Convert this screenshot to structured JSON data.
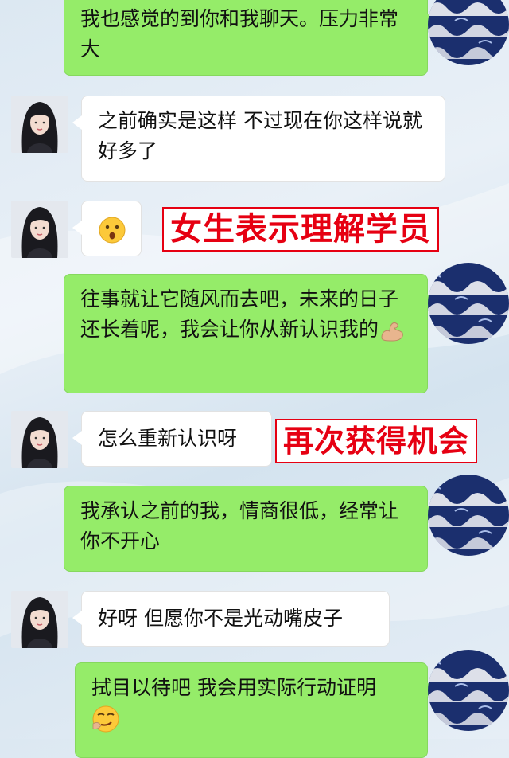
{
  "messages": [
    {
      "from": "me",
      "text": "我也感觉的到你和我聊天。压力非常大"
    },
    {
      "from": "her",
      "text": "之前确实是这样 不过现在你这样说就好多了"
    },
    {
      "from": "her",
      "text": "",
      "emoji": "surprised-face-emoji"
    },
    {
      "from": "me",
      "text": "往事就让它随风而去吧，未来的日子还长着呢，我会让你从新认识我的",
      "emoji": "flexed-biceps-emoji"
    },
    {
      "from": "her",
      "text": "怎么重新认识呀"
    },
    {
      "from": "me",
      "text": "我承认之前的我，情商很低，经常让你不开心"
    },
    {
      "from": "her",
      "text": "好呀 但愿你不是光动嘴皮子"
    },
    {
      "from": "me",
      "text": "拭目以待吧 我会用实际行动证明",
      "emoji": "smirking-face-emoji"
    }
  ],
  "annotations": {
    "understand": "女生表示理解学员",
    "chance": "再次获得机会"
  },
  "colors": {
    "me_bubble": "#95ec69",
    "her_bubble": "#ffffff",
    "annotation": "#e60012"
  }
}
